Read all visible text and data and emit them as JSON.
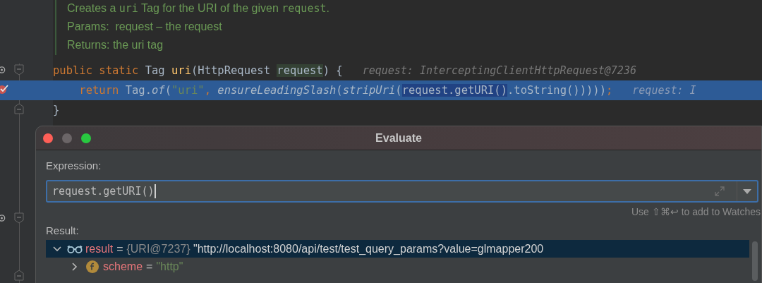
{
  "editor": {
    "doc_comment": [
      [
        {
          "text": "Creates a ",
          "kind": "text"
        },
        {
          "text": "uri",
          "kind": "code"
        },
        {
          "text": " Tag for the URI of the given ",
          "kind": "text"
        },
        {
          "text": "request",
          "kind": "code"
        },
        {
          "text": ".",
          "kind": "text"
        }
      ],
      [
        {
          "text": "Params:  request – the request",
          "kind": "text"
        }
      ],
      [
        {
          "text": "Returns: the uri tag",
          "kind": "text"
        }
      ]
    ],
    "lines": [
      {
        "override": true,
        "breakpoint": false,
        "fold_start": true,
        "fold_end": false,
        "current": false,
        "tokens": [
          {
            "text": "public static ",
            "kind": "keyword"
          },
          {
            "text": "Tag ",
            "kind": "plain"
          },
          {
            "text": "uri",
            "kind": "decl"
          },
          {
            "text": "(HttpRequest ",
            "kind": "plain"
          },
          {
            "text": "request",
            "kind": "param"
          },
          {
            "text": ") {",
            "kind": "plain"
          }
        ],
        "hint": "request: InterceptingClientHttpRequest@7236"
      },
      {
        "override": false,
        "breakpoint": true,
        "fold_start": false,
        "fold_end": false,
        "current": true,
        "tokens": [
          {
            "text": "    return ",
            "kind": "keyword"
          },
          {
            "text": "Tag.",
            "kind": "plain"
          },
          {
            "text": "of",
            "kind": "static"
          },
          {
            "text": "(",
            "kind": "plain"
          },
          {
            "text": "\"uri\"",
            "kind": "string"
          },
          {
            "text": ", ",
            "kind": "keyword"
          },
          {
            "text": "ensureLeadingSlash",
            "kind": "static"
          },
          {
            "text": "(",
            "kind": "plain"
          },
          {
            "text": "stripUri",
            "kind": "static"
          },
          {
            "text": "(",
            "kind": "plain"
          },
          {
            "text": "request.getURI()",
            "kind": "selected"
          },
          {
            "text": ".toString()))))",
            "kind": "plain"
          },
          {
            "text": ";",
            "kind": "keyword"
          }
        ],
        "hint": "request: I"
      },
      {
        "override": false,
        "breakpoint": false,
        "fold_start": false,
        "fold_end": true,
        "current": false,
        "tokens": [
          {
            "text": "}",
            "kind": "plain"
          }
        ]
      }
    ],
    "gutter_below": [
      {
        "override": true,
        "breakpoint": false,
        "fold_start": true,
        "fold_end": false
      },
      {
        "override": false,
        "breakpoint": false,
        "fold_start": false,
        "fold_end": true
      }
    ]
  },
  "dialog": {
    "title": "Evaluate",
    "expression_label": "Expression:",
    "expression": "request.getURI()",
    "watch_hint": "Use ⇧⌘↩ to add to Watches",
    "result_label": "Result:",
    "tree": [
      {
        "kind": "watch",
        "name": "result",
        "operator": "=",
        "type": "{URI@7237}",
        "value": "\"http://localhost:8080/api/test/test_query_params?value=glmapper200",
        "expanded": true,
        "selected": true,
        "children": [
          {
            "kind": "field",
            "name": "scheme",
            "operator": "=",
            "value": "\"http\"",
            "expanded": false,
            "selected": false
          }
        ]
      }
    ]
  }
}
